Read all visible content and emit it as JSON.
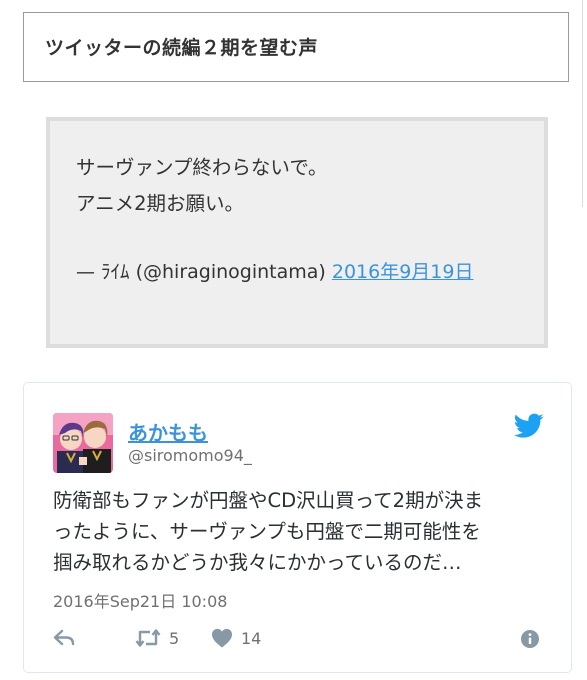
{
  "section_heading": "ツイッターの続編２期を望む声",
  "embedded_quote": {
    "line1": "サーヴァンプ終わらないで。",
    "line2": "アニメ2期お願い。",
    "credit": "— ﾗｲﾑ (@hiraginogintama)",
    "date_link": "2016年9月19日"
  },
  "tweet": {
    "display_name": "あかもも",
    "screen_name": "@siromomo94_",
    "text_lines": [
      "防衛部もファンが円盤やCD沢山買って2期が決ま",
      "ったように、サーヴァンプも円盤で二期可能性を",
      "掴み取れるかどうか我々にかかっているのだ…"
    ],
    "timestamp": "2016年Sep21日 10:08",
    "retweet_count": "5",
    "like_count": "14",
    "icons": {
      "brand": "twitter-bird-icon",
      "reply": "reply-icon",
      "retweet": "retweet-icon",
      "like": "heart-icon",
      "info": "info-icon"
    },
    "colors": {
      "link": "#3b94d9",
      "twitter_blue": "#1da1f2",
      "action_gray": "#8899a6"
    }
  }
}
